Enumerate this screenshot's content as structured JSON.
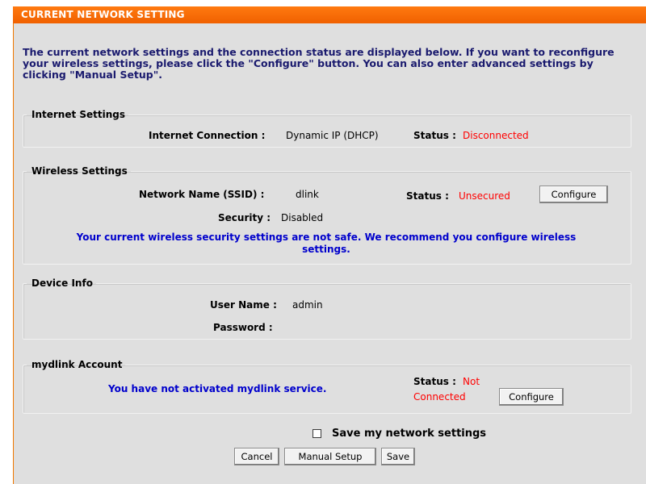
{
  "header": {
    "title": "CURRENT NETWORK SETTING"
  },
  "intro": "The current network settings and the connection status are displayed below. If you want to reconfigure your wireless settings, please click the \"Configure\" button. You can also enter advanced settings by clicking \"Manual Setup\".",
  "internet": {
    "legend": "Internet Settings",
    "connection_label": "Internet Connection :",
    "connection_value": "Dynamic IP (DHCP)",
    "status_label": "Status :",
    "status_value": "Disconnected"
  },
  "wireless": {
    "legend": "Wireless Settings",
    "ssid_label": "Network Name (SSID) :",
    "ssid_value": "dlink",
    "status_label": "Status :",
    "status_value": "Unsecured",
    "configure_label": "Configure",
    "security_label": "Security :",
    "security_value": "Disabled",
    "warning_line1": "Your current wireless security settings are not safe. We recommend you configure wireless",
    "warning_line2": "settings."
  },
  "device": {
    "legend": "Device Info",
    "username_label": "User Name :",
    "username_value": "admin",
    "password_label": "Password :",
    "password_value": ""
  },
  "mydlink": {
    "legend": "mydlink Account",
    "message": "You have not activated mydlink service.",
    "status_label": "Status :",
    "status_value_line1": "Not",
    "status_value_line2": "Connected",
    "configure_label": "Configure"
  },
  "footer": {
    "save_checkbox_label": "Save my network settings",
    "save_checked": false,
    "cancel_label": "Cancel",
    "manual_setup_label": "Manual Setup",
    "save_label": "Save"
  },
  "colors": {
    "header_bg": "#ff6f00",
    "panel_bg": "#dfdfdf",
    "status_red": "#ff0000",
    "warning_blue": "#0000cc",
    "intro_text": "#1a1a6e"
  }
}
